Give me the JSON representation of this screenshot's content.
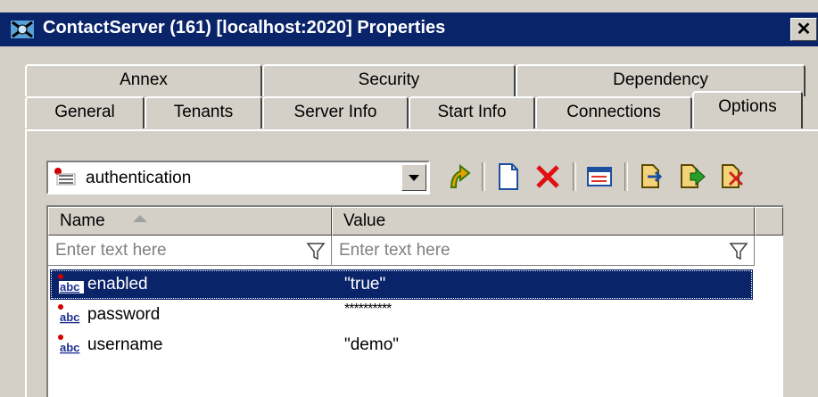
{
  "window": {
    "title": "ContactServer (161) [localhost:2020] Properties",
    "close_glyph": "✕"
  },
  "tabs_row_back": [
    {
      "label": "Annex"
    },
    {
      "label": "Security"
    },
    {
      "label": "Dependency"
    }
  ],
  "tabs_row_front": [
    {
      "label": "General"
    },
    {
      "label": "Tenants"
    },
    {
      "label": "Server Info"
    },
    {
      "label": "Start Info"
    },
    {
      "label": "Connections"
    },
    {
      "label": "Options",
      "active": true
    }
  ],
  "options": {
    "section_selected": "authentication",
    "toolbar": [
      {
        "icon": "move-up-icon"
      },
      {
        "icon": "new-document-icon"
      },
      {
        "icon": "delete-icon"
      },
      {
        "icon": "edit-icon"
      },
      {
        "icon": "import-icon"
      },
      {
        "icon": "export-icon"
      },
      {
        "icon": "export-all-icon"
      }
    ],
    "columns": [
      {
        "label": "Name",
        "filter_placeholder": "Enter text here"
      },
      {
        "label": "Value",
        "filter_placeholder": "Enter text here"
      }
    ],
    "rows": [
      {
        "name": "enabled",
        "value": "\"true\"",
        "selected": true
      },
      {
        "name": "password",
        "value": "**********"
      },
      {
        "name": "username",
        "value": "\"demo\""
      }
    ]
  },
  "colors": {
    "title_bar": "#0a246a",
    "selection": "#0a246a",
    "face": "#d4d0c8"
  }
}
